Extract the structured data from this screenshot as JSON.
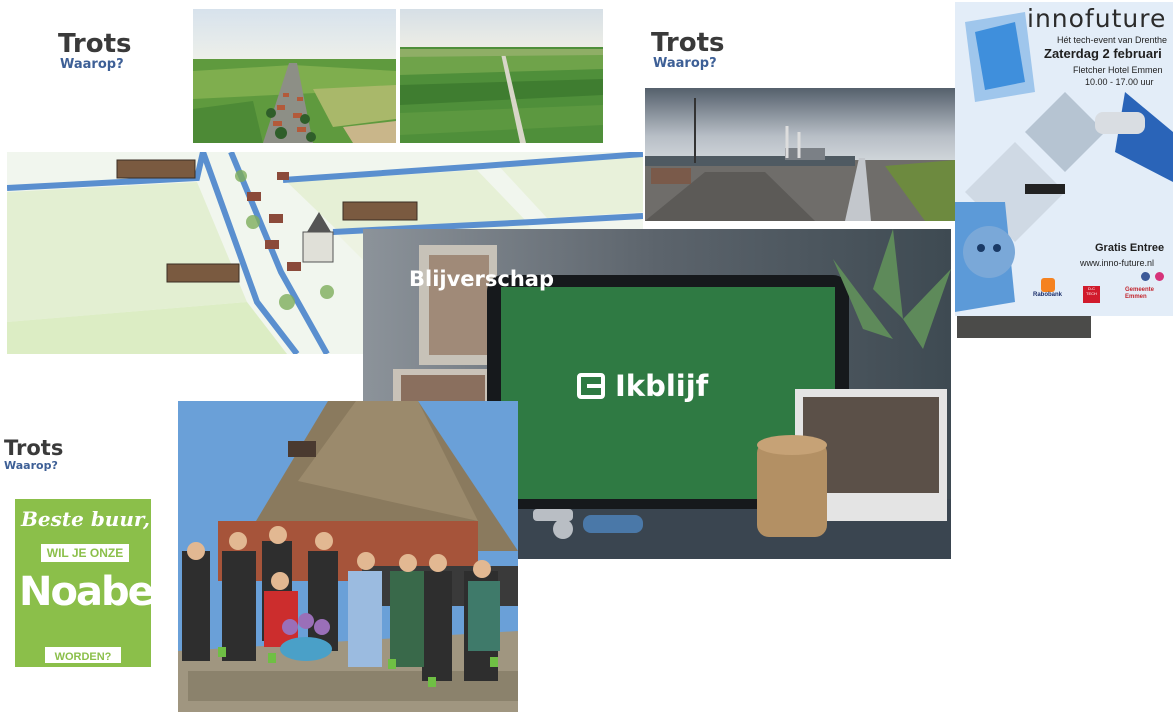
{
  "captions": [
    {
      "title": "Trots",
      "subtitle": "Waarop?"
    },
    {
      "title": "Trots",
      "subtitle": "Waarop?"
    },
    {
      "title": "Trots",
      "subtitle": "Waarop?"
    }
  ],
  "blijverschap": {
    "title": "Blijverschap",
    "tablet_text": "Ikblijf"
  },
  "poster": {
    "brand": "innofuture",
    "tagline": "Hét tech-event van Drenthe",
    "date": "Zaterdag 2 februari",
    "venue": "Fletcher Hotel Emmen",
    "time": "10.00 - 17.00 uur",
    "entry": "Gratis Entree",
    "url": "www.inno-future.nl",
    "sponsors": [
      "Rabobank",
      "D-C TECH",
      "Gemeente Emmen"
    ]
  },
  "noaber_card": {
    "line1": "Beste buur,",
    "line2": "WIL JE ONZE",
    "line3": "Noaber",
    "line4": "WORDEN?"
  },
  "colors": {
    "title_text": "#3a3a3a",
    "subtitle_text": "#3d5f96",
    "noaber_green": "#8bbf4a",
    "tablet_green": "#2f7a43"
  }
}
